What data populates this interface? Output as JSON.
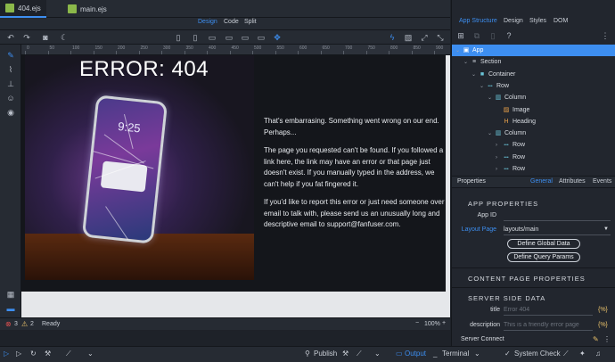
{
  "file_tabs": [
    {
      "label": "404.ejs",
      "active": true
    },
    {
      "label": "main.ejs",
      "active": false
    }
  ],
  "view_modes": [
    "Design",
    "Code",
    "Split"
  ],
  "active_view_mode": "Design",
  "ruler_labels": [
    "0",
    "50",
    "100",
    "150",
    "200",
    "250",
    "300",
    "350",
    "400",
    "450",
    "500",
    "550",
    "600",
    "650",
    "700",
    "750",
    "800",
    "850",
    "900"
  ],
  "page": {
    "error_title": "ERROR: 404",
    "phone_time": "9:25",
    "paragraphs": [
      "That's embarrasing. Something went wrong on our end. Perhaps...",
      "The page you requested can't be found. If you followed a link here, the link may have an error or that page just doesn't exist. If you manually typed in the address, we can't help if you fat fingered it.",
      "If you'd like to report this error or just need someone over email to talk with, please send us an unusually long and descriptive email to support@fanfuser.com."
    ]
  },
  "status": {
    "errors": "3",
    "warnings": "2",
    "state": "Ready",
    "zoom": "100%"
  },
  "right_panel": {
    "tabs": [
      "App Structure",
      "Design",
      "Styles",
      "DOM"
    ],
    "active_tab": "App Structure",
    "tree": [
      {
        "label": "App",
        "depth": 0,
        "icon": "app",
        "expanded": true
      },
      {
        "label": "Section",
        "depth": 1,
        "icon": "section",
        "expanded": true
      },
      {
        "label": "Container",
        "depth": 2,
        "icon": "container",
        "expanded": true
      },
      {
        "label": "Row",
        "depth": 3,
        "icon": "row",
        "expanded": true
      },
      {
        "label": "Column",
        "depth": 4,
        "icon": "column",
        "expanded": true
      },
      {
        "label": "Image",
        "depth": 5,
        "icon": "image",
        "expanded": false
      },
      {
        "label": "Heading",
        "depth": 5,
        "icon": "heading",
        "expanded": false
      },
      {
        "label": "Column",
        "depth": 4,
        "icon": "column",
        "expanded": true
      },
      {
        "label": "Row",
        "depth": 5,
        "icon": "row",
        "expanded": false
      },
      {
        "label": "Row",
        "depth": 5,
        "icon": "row",
        "expanded": false
      },
      {
        "label": "Row",
        "depth": 5,
        "icon": "row",
        "expanded": false
      }
    ],
    "properties_title": "Properties",
    "properties_tabs": [
      "General",
      "Attributes",
      "Events"
    ],
    "active_properties_tab": "General",
    "app_properties_heading": "APP PROPERTIES",
    "app_id_label": "App ID",
    "app_id_value": "",
    "layout_page_label": "Layout Page",
    "layout_page_value": "layouts/main",
    "define_global_data": "Define Global Data",
    "define_query_params": "Define Query Params",
    "content_page_heading": "CONTENT PAGE PROPERTIES",
    "server_side_heading": "SERVER SIDE DATA",
    "title_label": "title",
    "title_placeholder": "Error 404",
    "description_label": "description",
    "description_placeholder": "This is a friendly error page",
    "braces_label": "{%}",
    "server_connect_label": "Server Connect"
  },
  "bottom_bar": {
    "publish": "Publish",
    "output": "Output",
    "terminal": "Terminal",
    "system_check": "System Check"
  },
  "colors": {
    "accent": "#3d8ef0",
    "background": "#1e2229",
    "panel": "#262b33",
    "page_bg": "#14161b"
  }
}
